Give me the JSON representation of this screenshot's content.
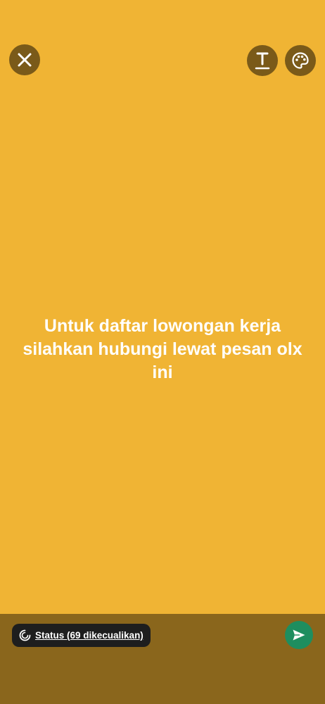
{
  "colors": {
    "background": "#F0B434",
    "button_bg": "#7A5A19",
    "icon": "#ffffff",
    "bottom_bar": "#8A661C",
    "chip_bg": "#1E1E1E",
    "send_bg": "#1E8E5F"
  },
  "toolbar": {
    "close_icon": "close-icon",
    "text_tool_icon": "text-tool-icon",
    "palette_icon": "palette-icon"
  },
  "status": {
    "text": "Untuk daftar lowongan kerja silahkan hubungi lewat pesan olx ini"
  },
  "footer": {
    "privacy_label": "Status (69 dikecualikan)",
    "privacy_icon": "status-ring-icon",
    "send_icon": "send-icon"
  }
}
